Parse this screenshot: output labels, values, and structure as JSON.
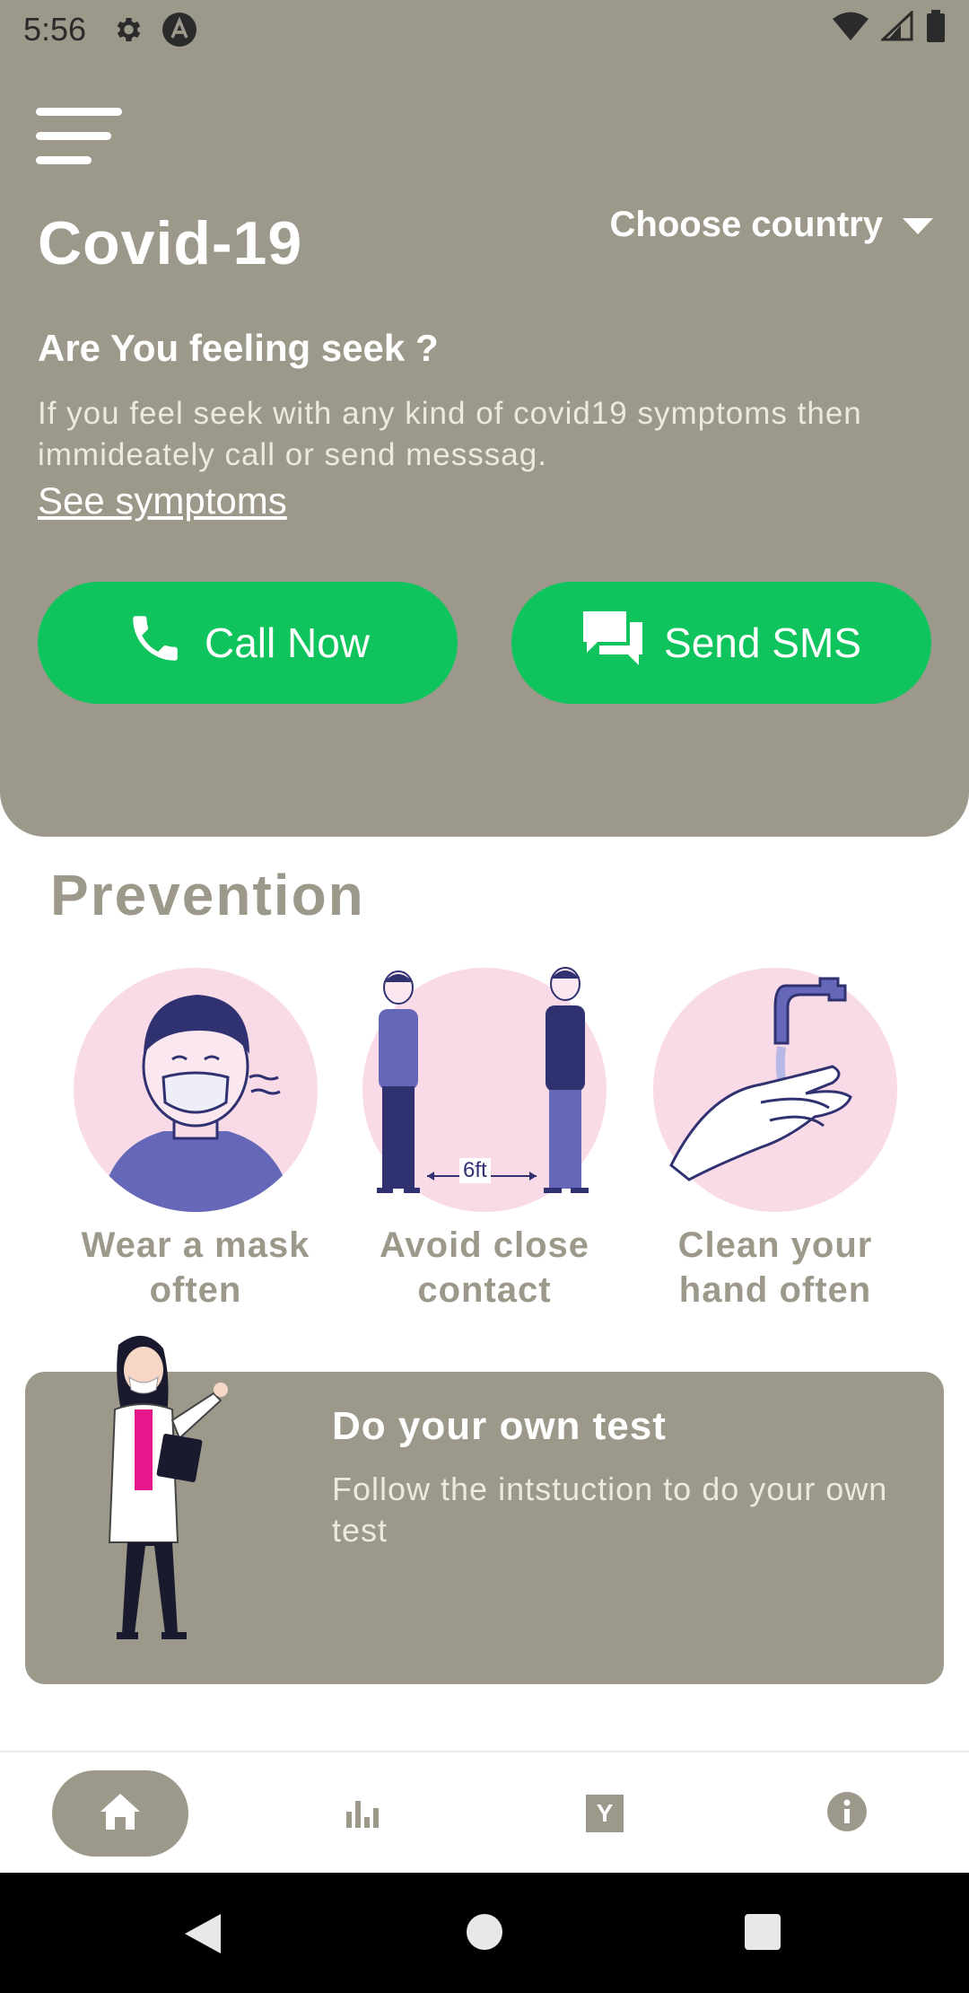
{
  "status_bar": {
    "time": "5:56"
  },
  "header": {
    "title": "Covid-19",
    "country_label": "Choose country",
    "question": "Are You feeling seek ?",
    "description": "If you feel seek with any kind of covid19 symptoms then immideately call or send messsag.",
    "link": "See symptoms",
    "call_label": "Call Now",
    "sms_label": "Send SMS"
  },
  "prevention": {
    "title": "Prevention",
    "items": [
      {
        "label_line1": "Wear a mask",
        "label_line2": "often"
      },
      {
        "label_line1": "Avoid close",
        "label_line2": "contact",
        "distance": "6ft"
      },
      {
        "label_line1": "Clean your",
        "label_line2": "hand often"
      }
    ]
  },
  "test_card": {
    "title": "Do your own test",
    "description": "Follow the intstuction to do your own test"
  },
  "bottom_nav": {
    "items": [
      "home-icon",
      "stats-icon",
      "y-icon",
      "info-icon"
    ],
    "active_index": 0,
    "y_letter": "Y"
  },
  "colors": {
    "primary": "#9d998a",
    "accent_green": "#0fc45c",
    "pink": "#f9dbe8",
    "indigo": "#5f5fb0"
  }
}
